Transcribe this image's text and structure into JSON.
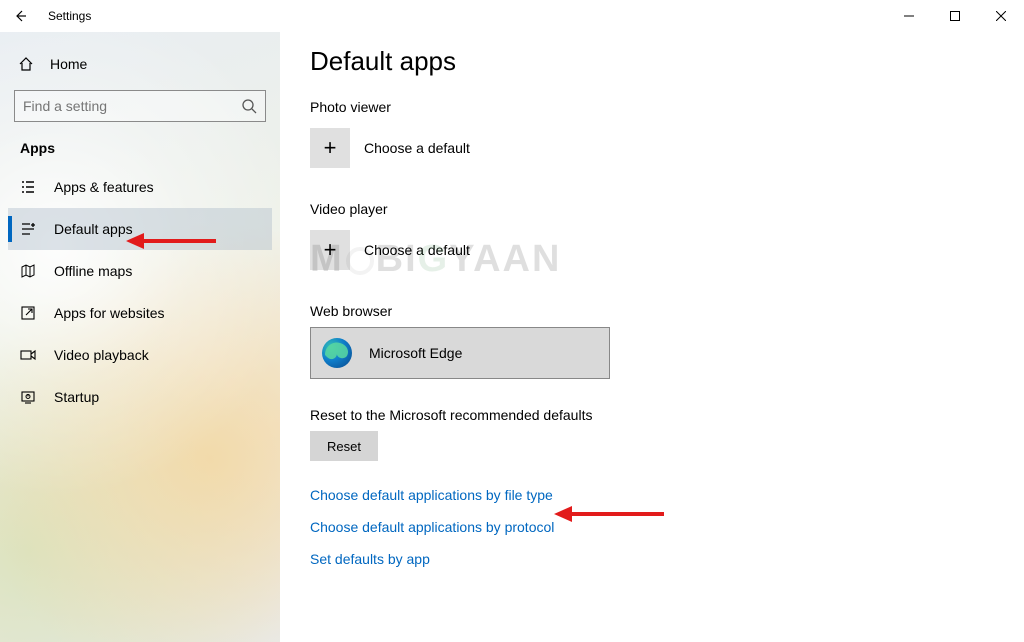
{
  "window": {
    "title": "Settings"
  },
  "sidebar": {
    "home": "Home",
    "search_placeholder": "Find a setting",
    "section": "Apps",
    "items": [
      {
        "label": "Apps & features"
      },
      {
        "label": "Default apps"
      },
      {
        "label": "Offline maps"
      },
      {
        "label": "Apps for websites"
      },
      {
        "label": "Video playback"
      },
      {
        "label": "Startup"
      }
    ]
  },
  "main": {
    "heading": "Default apps",
    "photo": {
      "label": "Photo viewer",
      "choose": "Choose a default"
    },
    "video": {
      "label": "Video player",
      "choose": "Choose a default"
    },
    "browser": {
      "label": "Web browser",
      "app": "Microsoft Edge"
    },
    "reset": {
      "label": "Reset to the Microsoft recommended defaults",
      "button": "Reset"
    },
    "links": {
      "by_file_type": "Choose default applications by file type",
      "by_protocol": "Choose default applications by protocol",
      "by_app": "Set defaults by app"
    }
  },
  "watermark": {
    "part1": "M",
    "part2": "BI",
    "part3": "G",
    "part4": "YAAN"
  }
}
